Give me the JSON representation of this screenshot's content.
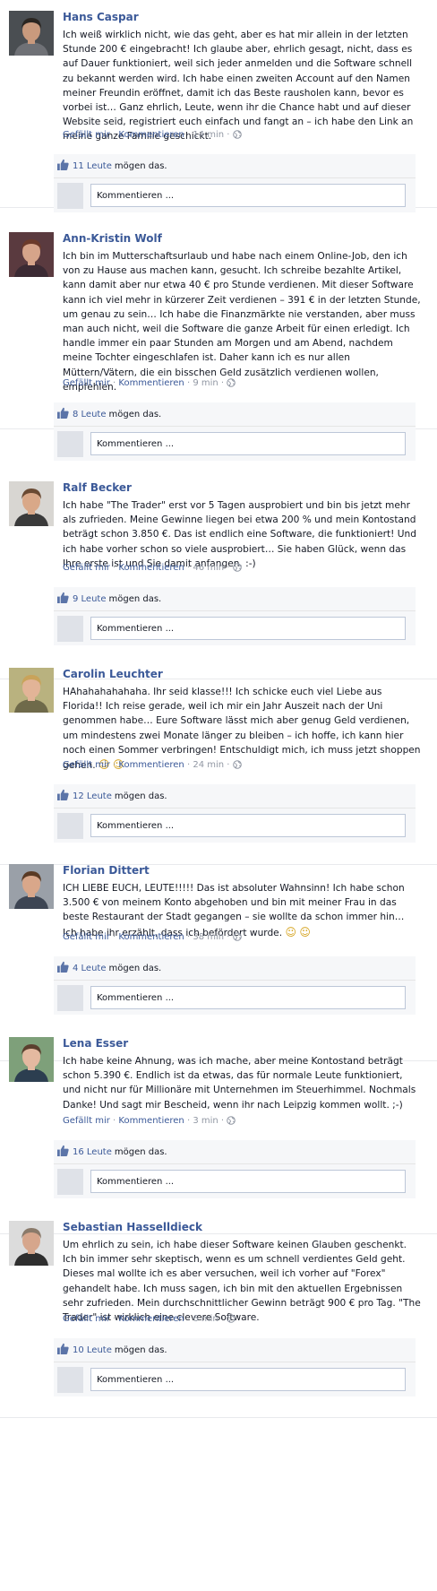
{
  "ui": {
    "like_action": "Gefällt mir",
    "comment_action": "Kommentieren",
    "likes_suffix": "mögen das.",
    "comment_placeholder": "Kommentieren ..."
  },
  "posts": [
    {
      "author": "Hans Caspar",
      "text": "Ich weiß wirklich nicht, wie das geht, aber es hat mir allein in der letzten Stunde 200 € eingebracht! Ich glaube aber, ehrlich gesagt, nicht, dass es auf Dauer funktioniert, weil sich jeder anmelden und die Software schnell zu bekannt werden wird. Ich habe einen zweiten Account auf den Namen meiner Freundin eröffnet, damit ich das Beste rausholen kann, bevor es vorbei ist… Ganz ehrlich, Leute, wenn ihr die Chance habt und auf dieser Website seid, registriert euch einfach und fangt an – ich habe den Link an meine ganze Familie geschickt.",
      "time": "14 min",
      "likes": "11 Leute",
      "colors": {
        "bg": "#4a4e52",
        "skin": "#c99a7d",
        "hair": "#2b2621",
        "shirt": "#6f7176"
      }
    },
    {
      "author": "Ann-Kristin Wolf",
      "text": "Ich bin im Mutterschaftsurlaub und habe nach einem Online-Job, den ich von zu Hause aus machen kann, gesucht. Ich schreibe bezahlte Artikel, kann damit aber nur etwa 40 € pro Stunde verdienen. Mit dieser Software kann ich viel mehr in kürzerer Zeit verdienen – 391 € in der letzten Stunde, um genau zu sein… Ich habe die Finanzmärkte nie verstanden, aber muss man auch nicht, weil die Software die ganze Arbeit für einen erledigt. Ich handle immer ein paar Stunden am Morgen und am Abend, nachdem meine Tochter eingeschlafen ist. Daher kann ich es nur allen Müttern/Vätern, die ein bisschen Geld zusätzlich verdienen wollen, empfehlen.",
      "time": "9 min",
      "likes": "8 Leute",
      "colors": {
        "bg": "#5a3a3f",
        "skin": "#d6a48a",
        "hair": "#6b3a2a",
        "shirt": "#3b2a33"
      }
    },
    {
      "author": "Ralf Becker",
      "text": "Ich habe \"The Trader\" erst vor 5 Tagen ausprobiert und bin bis jetzt mehr als zufrieden. Meine Gewinne liegen bei etwa 200 % und mein Kontostand beträgt schon 3.850 €. Das ist endlich eine Software, die funktioniert! Und ich habe vorher schon so viele ausprobiert… Sie haben Glück, wenn das Ihre erste ist und Sie damit anfangen. :-)",
      "time": "46 min",
      "likes": "9 Leute",
      "colors": {
        "bg": "#d8d6d2",
        "skin": "#d9a888",
        "hair": "#6a4a33",
        "shirt": "#3a3a3a"
      }
    },
    {
      "author": "Carolin Leuchter",
      "text": "HAhahahahahaha. Ihr seid klasse!!! Ich schicke euch viel Liebe aus Florida!! Ich reise gerade, weil ich mir ein Jahr Auszeit nach der Uni genommen habe… Eure Software lässt mich aber genug Geld verdienen, um mindestens zwei Monate länger zu bleiben – ich hoffe, ich kann hier noch einen Sommer verbringen! Entschuldigt mich, ich muss jetzt shoppen gehen.",
      "emojis": [
        "☺",
        "☺"
      ],
      "time": "24 min",
      "likes": "12 Leute",
      "colors": {
        "bg": "#b9b27f",
        "skin": "#e2b497",
        "hair": "#c9a35a",
        "shirt": "#6f6a4a"
      }
    },
    {
      "author": "Florian Dittert",
      "text": "ICH LIEBE EUCH, LEUTE!!!!! Das ist absoluter Wahnsinn! Ich habe schon 3.500 € von meinem Konto abgehoben und bin mit meiner Frau in das beste Restaurant der Stadt gegangen – sie wollte da schon immer hin… Ich habe ihr erzählt, dass ich befördert wurde.",
      "emojis": [
        "☺",
        "☺"
      ],
      "time": "38 min",
      "likes": "4 Leute",
      "colors": {
        "bg": "#9aa0a8",
        "skin": "#d9a78a",
        "hair": "#5a3a24",
        "shirt": "#3d4553"
      }
    },
    {
      "author": "Lena Esser",
      "text": "Ich habe keine Ahnung, was ich mache, aber meine Kontostand beträgt schon 5.390 €. Endlich ist da etwas, das für normale Leute funktioniert, und nicht nur für Millionäre mit Unternehmen im Steuerhimmel. Nochmals Danke! Und sagt mir Bescheid, wenn ihr nach Leipzig kommen wollt. ;-)",
      "time": "3 min",
      "likes": "16 Leute",
      "colors": {
        "bg": "#7ea07a",
        "skin": "#e4b9a0",
        "hair": "#5b3f2e",
        "shirt": "#2c3e50"
      }
    },
    {
      "author": "Sebastian Hasselldieck",
      "text": "Um ehrlich zu sein, ich habe dieser Software keinen Glauben geschenkt. Ich bin immer sehr skeptisch, wenn es um schnell verdientes Geld geht. Dieses mal wollte ich es aber versuchen, weil ich vorher auf \"Forex\" gehandelt habe. Ich muss sagen, ich bin mit den aktuellen Ergebnissen sehr zufrieden. Mein durchschnittlicher Gewinn beträgt 900 € pro Tag. \"The Trader\" ist wirklich eine clevere Software.",
      "time": "6 min",
      "likes": "10 Leute",
      "colors": {
        "bg": "#dcdcdc",
        "skin": "#d6a68c",
        "hair": "#8a7a6a",
        "shirt": "#2e2e2e"
      }
    }
  ]
}
